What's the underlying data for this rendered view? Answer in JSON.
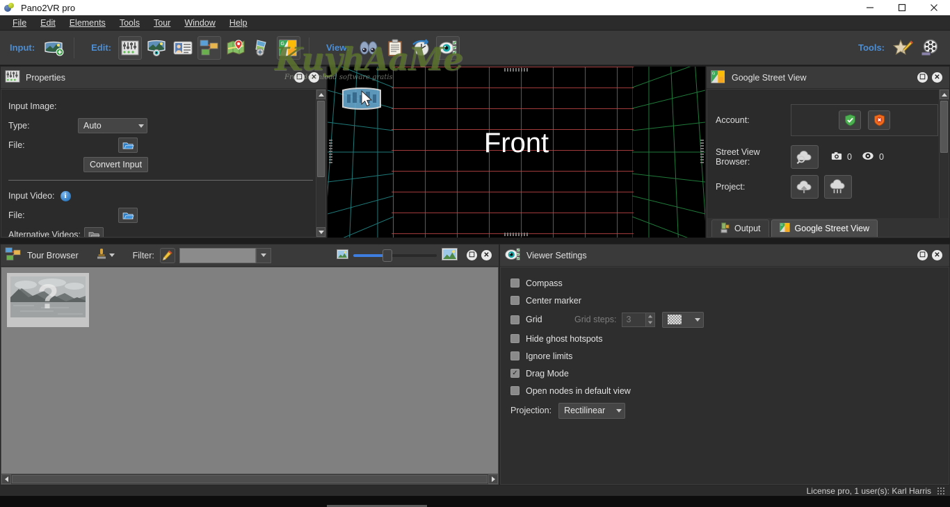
{
  "window": {
    "title": "Pano2VR pro",
    "app_icon": "pano2vr-icon",
    "minimize_label": "Minimize",
    "maximize_label": "Maximize",
    "close_label": "Close"
  },
  "menubar": {
    "items": [
      {
        "label": "File",
        "accel": "F"
      },
      {
        "label": "Edit",
        "accel": "E"
      },
      {
        "label": "Elements",
        "accel": "l"
      },
      {
        "label": "Tools",
        "accel": "T"
      },
      {
        "label": "Tour",
        "accel": "o"
      },
      {
        "label": "Window",
        "accel": "W"
      },
      {
        "label": "Help",
        "accel": "H"
      }
    ]
  },
  "toolbar": {
    "input_label": "Input:",
    "edit_label": "Edit:",
    "view_label": "View:",
    "tools_label": "Tools:",
    "input_buttons": [
      {
        "name": "open-input-image-button",
        "icon": "panorama-add-icon"
      }
    ],
    "edit_buttons": [
      {
        "name": "properties-button",
        "icon": "sliders-icon",
        "active": true
      },
      {
        "name": "panorama-viewer-button",
        "icon": "panorama-eye-icon",
        "active": false
      },
      {
        "name": "user-data-button",
        "icon": "id-card-icon",
        "active": false
      },
      {
        "name": "tour-browser-button",
        "icon": "tour-nodes-icon",
        "active": true
      },
      {
        "name": "map-button",
        "icon": "map-pin-icon",
        "active": false
      },
      {
        "name": "skin-editor-button",
        "icon": "skin-editor-icon",
        "active": false
      },
      {
        "name": "google-street-view-button",
        "icon": "google-street-view-icon",
        "active": true
      }
    ],
    "view_buttons": [
      {
        "name": "preview-button",
        "icon": "binoculars-icon"
      },
      {
        "name": "output-log-button",
        "icon": "clipboard-icon"
      },
      {
        "name": "animation-button",
        "icon": "compass-clock-icon"
      },
      {
        "name": "viewer-settings-button",
        "icon": "eye-settings-icon",
        "active": true
      }
    ],
    "tools_buttons": [
      {
        "name": "skin-star-button",
        "icon": "star-pencil-icon"
      },
      {
        "name": "video-reel-button",
        "icon": "film-reel-icon"
      }
    ]
  },
  "properties": {
    "title": "Properties",
    "icon": "sliders-icon",
    "float_label": "Float",
    "close_label": "Close",
    "input_image_heading": "Input Image:",
    "type_label": "Type:",
    "type_value": "Auto",
    "type_options": [
      "Auto"
    ],
    "file_label": "File:",
    "file_browse_icon": "folder-open-icon",
    "convert_input_label": "Convert Input",
    "input_video_heading": "Input Video:",
    "input_video_info_icon": "info-icon",
    "video_file_label": "File:",
    "alternative_videos_label": "Alternative Videos:"
  },
  "viewport": {
    "face_label": "Front",
    "thumb_overlay_icon": "panorama-thumb-icon",
    "cursor_icon": "arrow-cursor-icon"
  },
  "street_view": {
    "title": "Google Street View",
    "icon": "google-street-view-icon",
    "float_label": "Float",
    "close_label": "Close",
    "account_label": "Account:",
    "account_connect_icon": "shield-check-icon",
    "account_disconnect_icon": "shield-x-icon",
    "browser_label": "Street View Browser:",
    "browser_icon": "cloud-search-icon",
    "photo_count_icon": "camera-icon",
    "photo_count": "0",
    "view_count_icon": "eye-icon",
    "view_count": "0",
    "project_label": "Project:",
    "project_upload_icon": "cloud-upload-icon",
    "project_delete_icon": "cloud-delete-icon",
    "tabs": [
      {
        "label": "Output",
        "icon": "output-icon",
        "active": false
      },
      {
        "label": "Google Street View",
        "icon": "google-street-view-icon",
        "active": true
      }
    ]
  },
  "tour_browser": {
    "title": "Tour Browser",
    "icon": "tour-nodes-icon",
    "float_label": "Float",
    "close_label": "Close",
    "node_tool_icon": "pin-stamp-icon",
    "node_tool_caret": "chevron-down-icon",
    "filter_label": "Filter:",
    "filter_edit_icon": "pencil-filter-icon",
    "filter_value": "",
    "filter_placeholder": "",
    "zoom_small_icon": "small-image-icon",
    "zoom_large_icon": "large-image-icon",
    "zoom_value": 35,
    "thumbnail": {
      "name": "node-thumbnail",
      "placeholder_glyph": "?"
    }
  },
  "viewer_settings": {
    "title": "Viewer Settings",
    "icon": "eye-settings-icon",
    "float_label": "Float",
    "close_label": "Close",
    "checkboxes": [
      {
        "label": "Compass",
        "checked": false,
        "name": "compass"
      },
      {
        "label": "Center marker",
        "checked": false,
        "name": "center-marker"
      },
      {
        "label": "Grid",
        "checked": false,
        "name": "grid"
      },
      {
        "label": "Hide ghost hotspots",
        "checked": false,
        "name": "hide-ghost-hotspots"
      },
      {
        "label": "Ignore limits",
        "checked": false,
        "name": "ignore-limits"
      },
      {
        "label": "Drag Mode",
        "checked": true,
        "name": "drag-mode"
      },
      {
        "label": "Open nodes in default view",
        "checked": false,
        "name": "open-nodes-default-view"
      }
    ],
    "grid_steps_label": "Grid steps:",
    "grid_steps_value": "3",
    "grid_color_icon": "checker-swatch-icon",
    "projection_label": "Projection:",
    "projection_value": "Rectilinear",
    "projection_options": [
      "Rectilinear"
    ]
  },
  "statusbar": {
    "license_text": "License pro, 1 user(s): Karl Harris",
    "resize_grip": "resize-grip-icon"
  },
  "watermark": {
    "text": "KuyhAaMe",
    "subtext": "Free download software gratis"
  },
  "colors": {
    "accent_blue": "#4b8ed6",
    "panel_bg": "#2e2e2e",
    "toolbar_bg": "#3a3a3a",
    "titlebar_bg": "#ffffff",
    "grid_red": "#be4646",
    "grid_green": "#1f7a3a",
    "grid_teal": "#1f7a7a",
    "slider_blue": "#3d7ee0"
  }
}
